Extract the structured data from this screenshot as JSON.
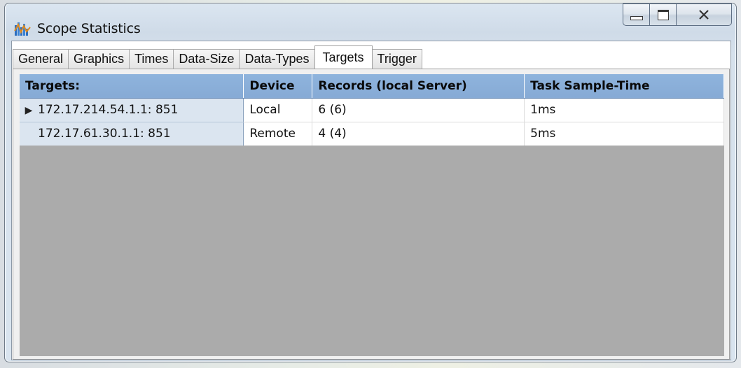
{
  "window": {
    "title": "Scope Statistics",
    "icon": "scope-statistics-app-icon",
    "caption_buttons": [
      "minimize",
      "maximize",
      "close"
    ]
  },
  "tabs": [
    {
      "label": "General",
      "active": false
    },
    {
      "label": "Graphics",
      "active": false
    },
    {
      "label": "Times",
      "active": false
    },
    {
      "label": "Data-Size",
      "active": false
    },
    {
      "label": "Data-Types",
      "active": false
    },
    {
      "label": "Targets",
      "active": true
    },
    {
      "label": "Trigger",
      "active": false
    }
  ],
  "table": {
    "columns": [
      "Targets:",
      "Device",
      "Records (local Server)",
      "Task Sample-Time"
    ],
    "rows": [
      {
        "target": "172.17.214.54.1.1: 851",
        "device": "Local",
        "records": "6 (6)",
        "sample_time": "1ms",
        "current": true
      },
      {
        "target": "172.17.61.30.1.1: 851",
        "device": "Remote",
        "records": "4 (4)",
        "sample_time": "5ms",
        "current": false
      }
    ]
  },
  "colors": {
    "header_bg": "#8fb4dd",
    "row_header_bg": "#dbe5f0",
    "empty_grid_bg": "#ababab"
  }
}
